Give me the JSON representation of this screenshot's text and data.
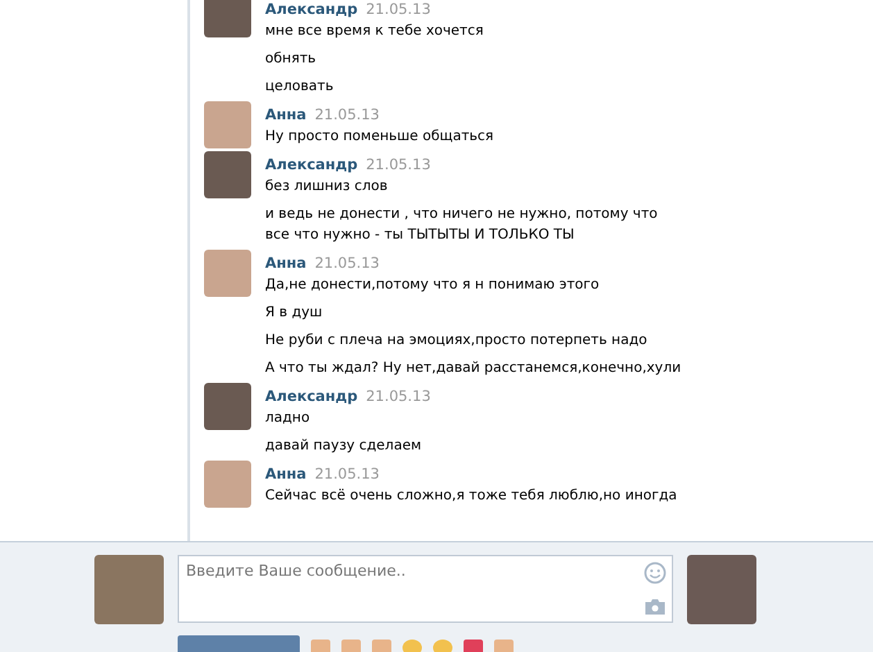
{
  "messages": [
    {
      "author": "Александр",
      "date": "21.05.13",
      "lines": [
        "мне все время к тебе хочется",
        "обнять",
        "целовать"
      ]
    },
    {
      "author": "Анна",
      "date": "21.05.13",
      "lines": [
        "Ну просто поменьше общаться"
      ]
    },
    {
      "author": "Александр",
      "date": "21.05.13",
      "lines": [
        "без лишниз слов",
        "и ведь не донести , что ничего не нужно, потому что все что нужно - ты ТЫТЫТЫ И ТОЛЬКО ТЫ"
      ]
    },
    {
      "author": "Анна",
      "date": "21.05.13",
      "lines": [
        "Да,не донести,потому что я н понимаю этого",
        "Я в душ",
        "Не руби с плеча на эмоциях,просто потерпеть надо",
        "А что ты ждал? Ну нет,давай расстанемся,конечно,хули"
      ]
    },
    {
      "author": "Александр",
      "date": "21.05.13",
      "lines": [
        "ладно",
        "давай паузу сделаем"
      ]
    },
    {
      "author": "Анна",
      "date": "21.05.13",
      "lines": [
        "Сейчас всё очень сложно,я тоже тебя люблю,но иногда"
      ]
    }
  ],
  "composer": {
    "placeholder": "Введите Ваше сообщение.."
  }
}
